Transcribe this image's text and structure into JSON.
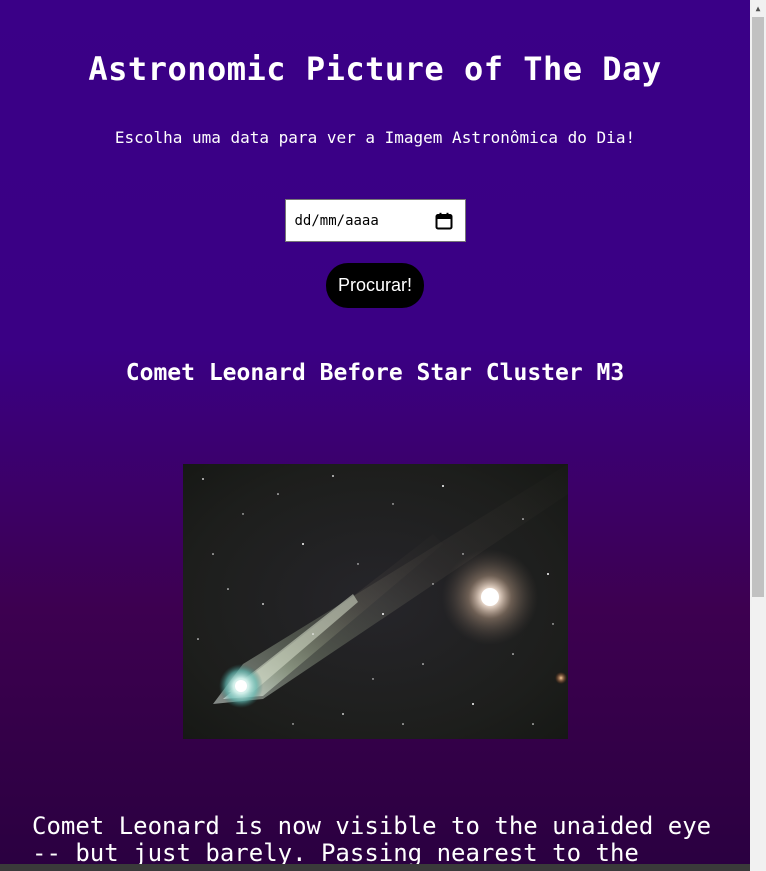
{
  "header": {
    "title": "Astronomic Picture of The Day",
    "subtitle": "Escolha uma data para ver a Imagem Astronômica do Dia!"
  },
  "date_picker": {
    "placeholder": "dd/mm/aaaa",
    "icon": "calendar-icon"
  },
  "search_button": {
    "label": "Procurar!"
  },
  "apod": {
    "title": "Comet Leonard Before Star Cluster M3",
    "image_alt": "Comet Leonard Before Star Cluster M3",
    "explanation": "Comet Leonard is now visible to the unaided eye -- but just barely. Passing nearest to the"
  },
  "colors": {
    "background_top": "#3a0087",
    "background_bottom": "#2a0040",
    "button_bg": "#000000",
    "text": "#ffffff"
  }
}
